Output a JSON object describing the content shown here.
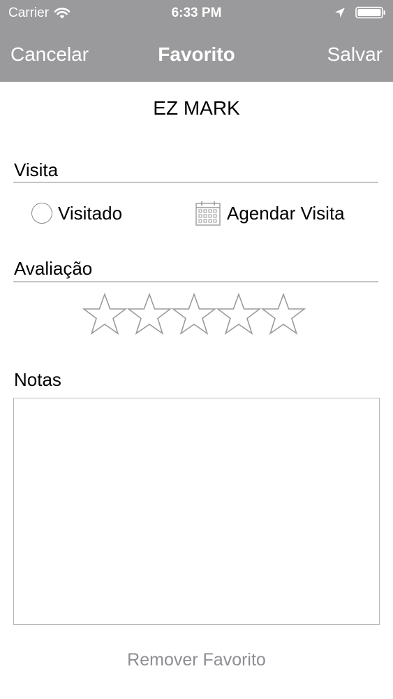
{
  "status_bar": {
    "carrier": "Carrier",
    "time": "6:33 PM",
    "icons": [
      "wifi-icon",
      "location-arrow-icon",
      "battery-icon"
    ]
  },
  "nav_bar": {
    "cancel_label": "Cancelar",
    "title": "Favorito",
    "save_label": "Salvar"
  },
  "place": {
    "name": "EZ MARK"
  },
  "visit": {
    "section_label": "Visita",
    "visited_label": "Visitado",
    "visited_checked": false,
    "schedule_label": "Agendar Visita",
    "schedule_icon": "calendar-icon"
  },
  "rating": {
    "section_label": "Avaliação",
    "value": 0,
    "max": 5,
    "icon": "star-icon"
  },
  "notes": {
    "section_label": "Notas",
    "value": ""
  },
  "actions": {
    "remove_label": "Remover Favorito"
  },
  "colors": {
    "nav_background": "#9a9a9c",
    "nav_text": "#ffffff",
    "divider": "#c4c4c4",
    "star_outline": "#9b9b9b",
    "remove_text": "#8e8e93"
  }
}
